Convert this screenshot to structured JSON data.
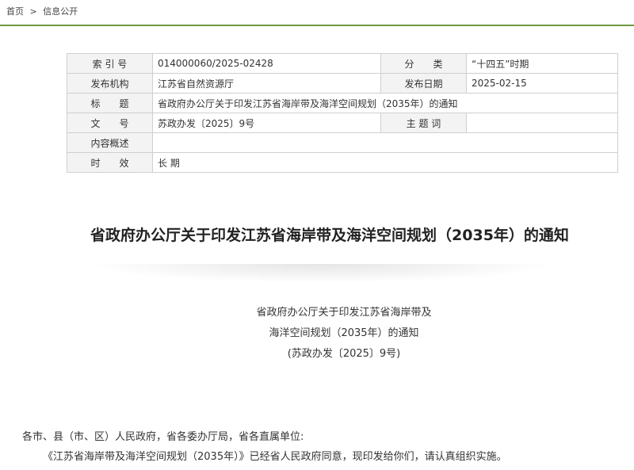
{
  "breadcrumb": {
    "home": "首页",
    "sep": ">",
    "current": "信息公开"
  },
  "meta": {
    "index_label": "索 引 号",
    "index_value": "014000060/2025-02428",
    "category_label": "分　　类",
    "category_value": "“十四五”时期",
    "issuer_label": "发布机构",
    "issuer_value": "江苏省自然资源厅",
    "date_label": "发布日期",
    "date_value": "2025-02-15",
    "title_label": "标　　题",
    "title_value": "省政府办公厅关于印发江苏省海岸带及海洋空间规划（2035年）的通知",
    "docno_label": "文　　号",
    "docno_value": "苏政办发〔2025〕9号",
    "keyword_label": "主 题 词",
    "keyword_value": "",
    "summary_label": "内容概述",
    "summary_value": "",
    "validity_label": "时　　效",
    "validity_value": "长 期"
  },
  "article": {
    "title": "省政府办公厅关于印发江苏省海岸带及海洋空间规划（2035年）的通知",
    "head_line1": "省政府办公厅关于印发江苏省海岸带及",
    "head_line2": "海洋空间规划（2035年）的通知",
    "head_line3": "(苏政办发〔2025〕9号)",
    "salutation": "各市、县（市、区）人民政府，省各委办厅局，省各直属单位:",
    "para1": "《江苏省海岸带及海洋空间规划（2035年）》已经省人民政府同意，现印发给你们，请认真组织实施。"
  }
}
